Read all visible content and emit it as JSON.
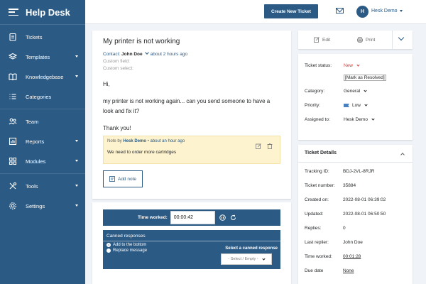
{
  "sidebar": {
    "title": "Help Desk",
    "items": [
      {
        "label": "Tickets",
        "icon": "clipboard-icon",
        "caret": false
      },
      {
        "label": "Templates",
        "icon": "layers-icon",
        "caret": true
      },
      {
        "label": "Knowledgebase",
        "icon": "book-icon",
        "caret": true
      },
      {
        "label": "Categories",
        "icon": "list-icon",
        "caret": false
      },
      {
        "label": "Team",
        "icon": "team-icon",
        "caret": false
      },
      {
        "label": "Reports",
        "icon": "chart-icon",
        "caret": true
      },
      {
        "label": "Modules",
        "icon": "modules-icon",
        "caret": true
      },
      {
        "label": "Tools",
        "icon": "tools-icon",
        "caret": true
      },
      {
        "label": "Settings",
        "icon": "gear-icon",
        "caret": true
      }
    ]
  },
  "topbar": {
    "new_ticket_label": "Create New Ticket",
    "avatar_initial": "H",
    "user_name": "Hesk Demo"
  },
  "ticket": {
    "title": "My printer is not working",
    "contact_label": "Contact:",
    "contact_name": "John Doe",
    "contact_time": "about 2 hours ago",
    "custom_field_label": "Custom field:",
    "custom_select_label": "Custom select:",
    "body": [
      "Hi,",
      "my printer is not working again... can you send someone to have a look and fix it?",
      "Thank you!"
    ],
    "note": {
      "prefix": "Note by",
      "author": "Hesk Demo",
      "time": "about an hour ago",
      "text": "We need to order more cartridges"
    },
    "add_note_label": "Add note"
  },
  "reply": {
    "time_worked_label": "Time worked:",
    "time_worked_value": "00:00:42",
    "canned_label": "Canned responses",
    "radio_add": "Add to the bottom",
    "radio_replace": "Replace message",
    "select_label": "Select a canned response",
    "select_value": "- Select / Empty -"
  },
  "actions": {
    "edit_label": "Edit",
    "print_label": "Print"
  },
  "properties": {
    "status_label": "Ticket status:",
    "status_value": "New",
    "mark_resolved": "Mark as Resolved",
    "category_label": "Category:",
    "category_value": "General",
    "priority_label": "Priority:",
    "priority_value": "Low",
    "assigned_label": "Assigned to:",
    "assigned_value": "Hesk Demo"
  },
  "details": {
    "title": "Ticket Details",
    "rows": [
      {
        "label": "Tracking ID:",
        "value": "BDJ-2VL-8RJR"
      },
      {
        "label": "Ticket number:",
        "value": "35884"
      },
      {
        "label": "Created on:",
        "value": "2022-08-01 06:39:02"
      },
      {
        "label": "Updated:",
        "value": "2022-08-01 06:50:50"
      },
      {
        "label": "Replies:",
        "value": "0"
      },
      {
        "label": "Last replier:",
        "value": "John Doe"
      },
      {
        "label": "Time worked:",
        "value": "00:01:28"
      },
      {
        "label": "Due date",
        "value": "None"
      }
    ]
  },
  "colors": {
    "sidebar": "#2b5a84",
    "status_new": "#d83c3c",
    "note_bg": "#fdf3cf"
  }
}
